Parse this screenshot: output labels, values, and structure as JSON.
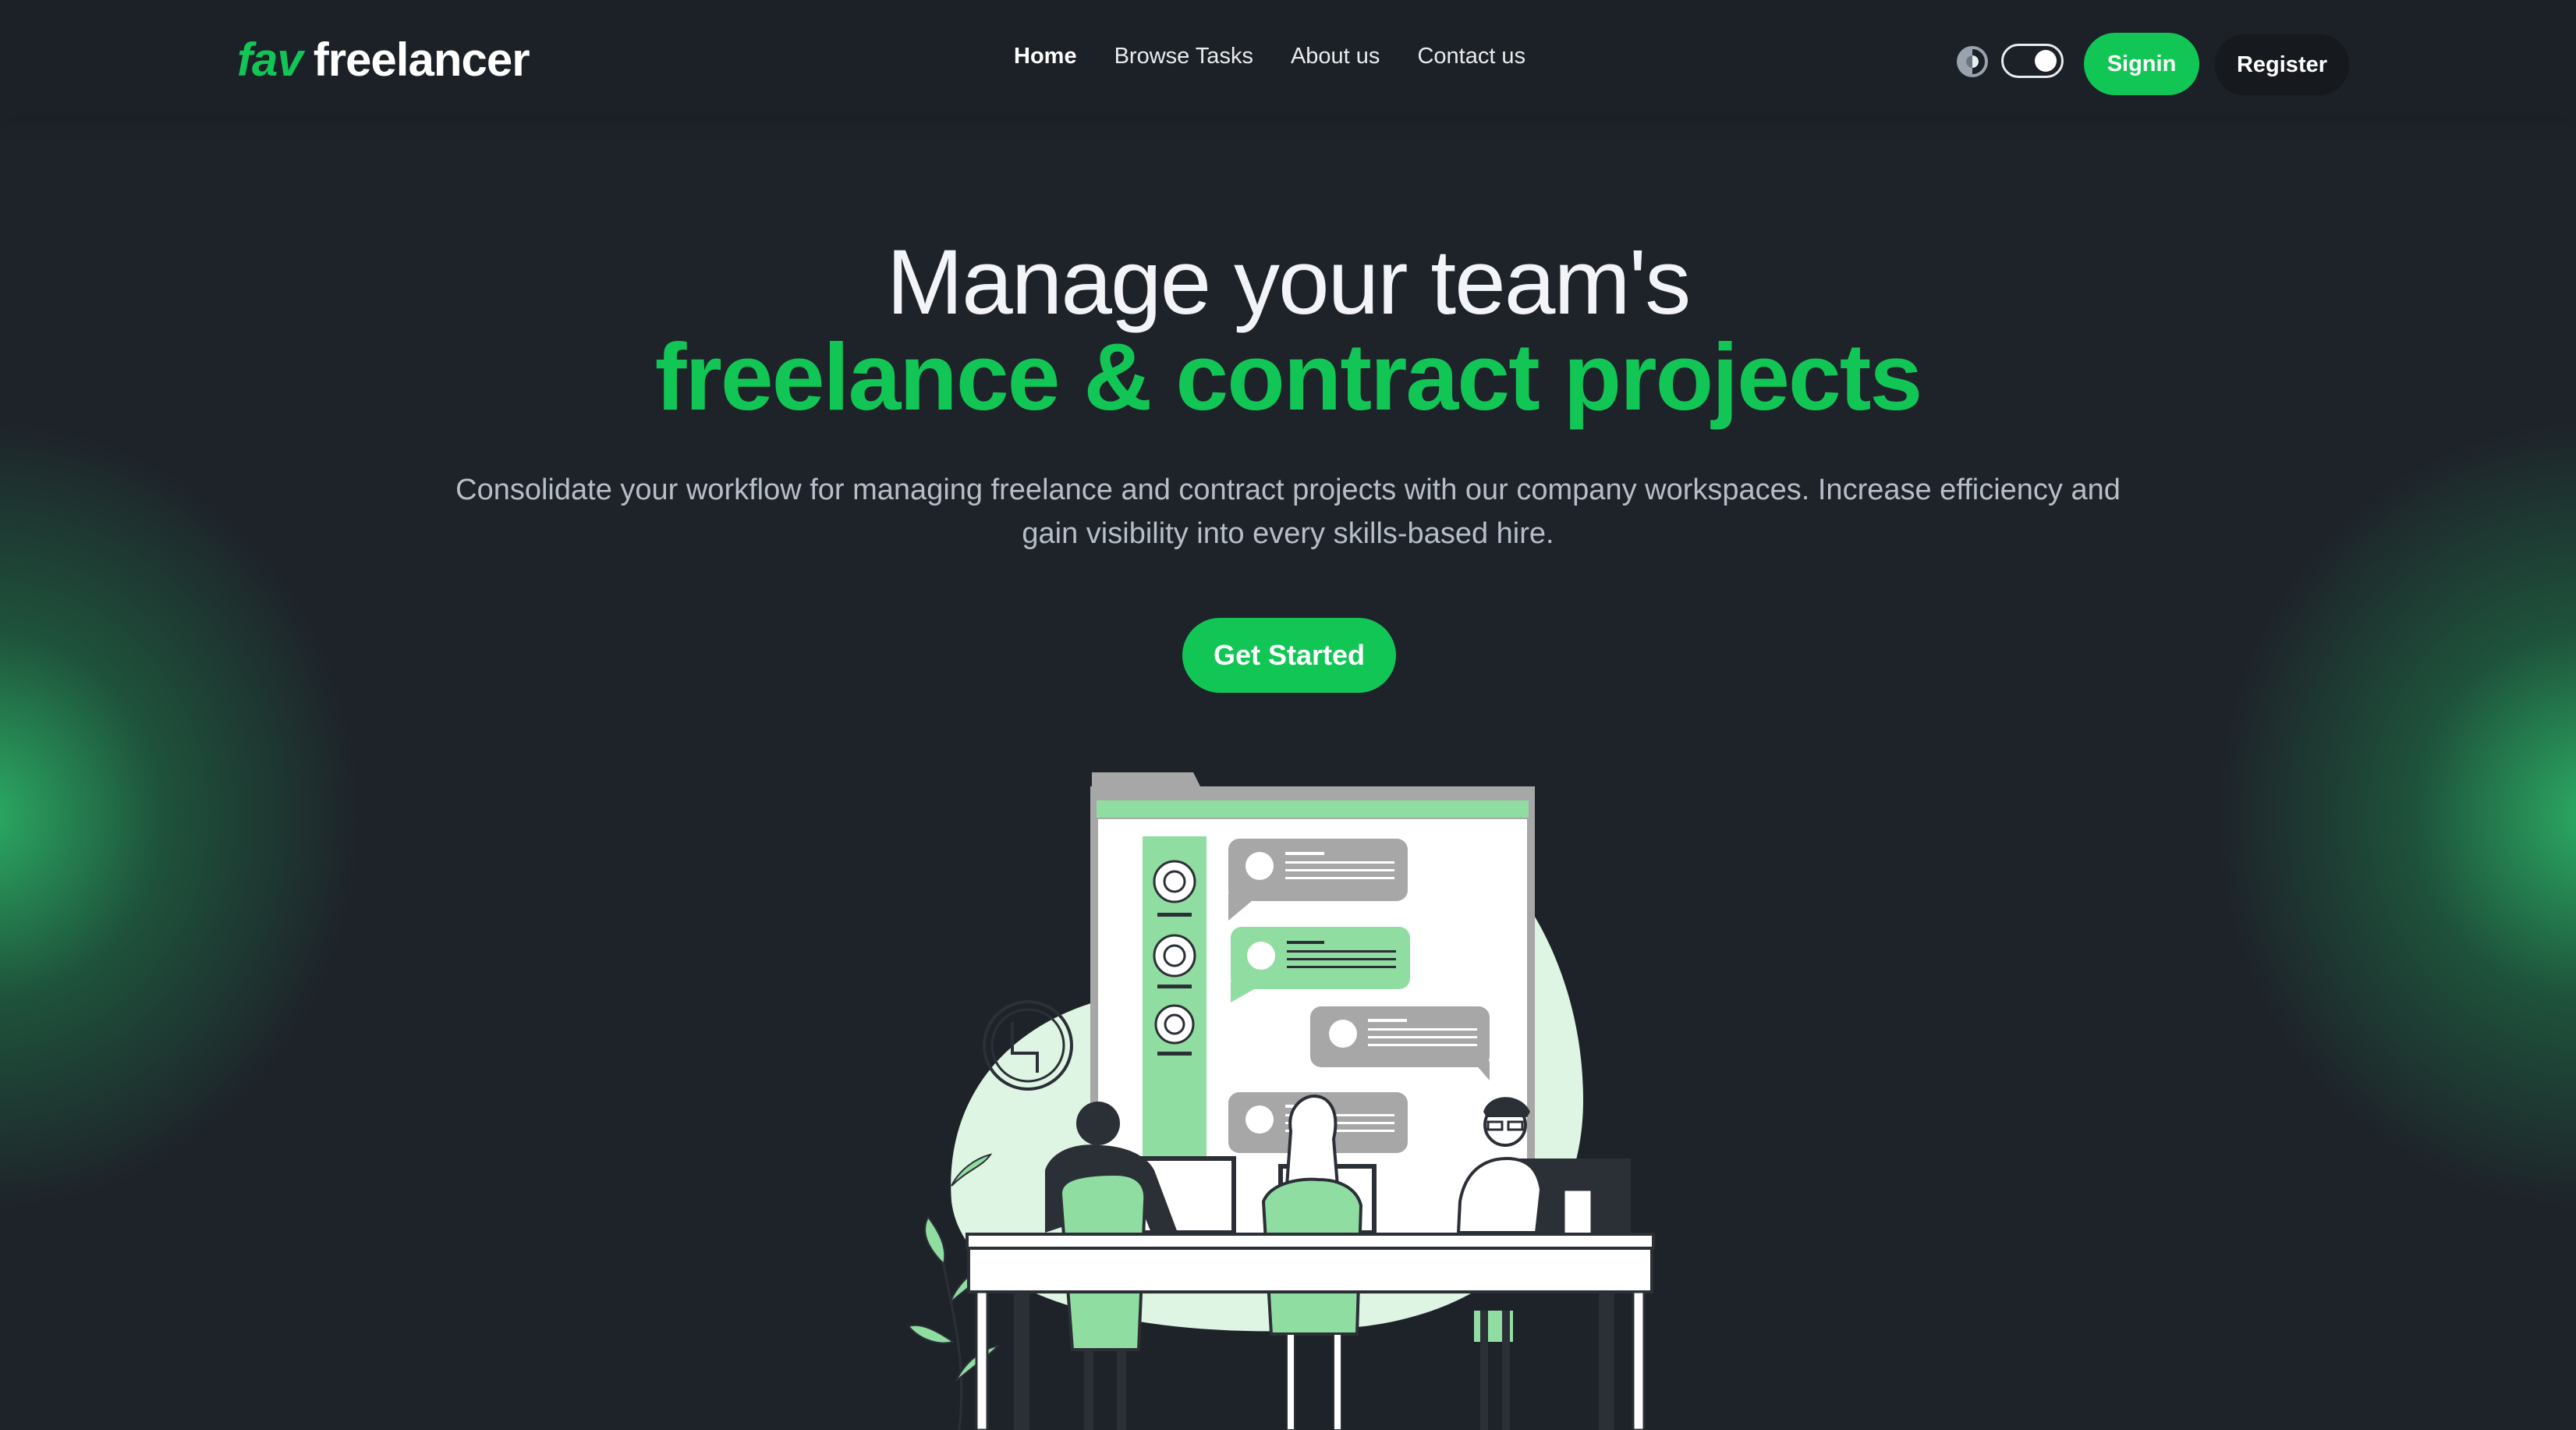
{
  "nav": {
    "logo_prefix": "fav",
    "logo_name": "freelancer",
    "links": [
      "Home",
      "Browse Tasks",
      "About us",
      "Contact us"
    ],
    "active_link": "Home",
    "theme_toggle_on": true,
    "signin_label": "Signin",
    "register_label": "Register"
  },
  "hero": {
    "title_line1": "Manage your team's",
    "title_line2": "freelance & contract projects",
    "subtitle": "Consolidate your workflow for managing freelance and contract projects with our company workspaces. Increase efficiency and gain visibility into every skills-based hire.",
    "cta_label": "Get Started"
  },
  "colors": {
    "accent": "#12c656",
    "background": "#1e232a",
    "navbar": "#1c2027",
    "illustration_light": "#dff5e3",
    "illustration_mid": "#90dda2"
  },
  "icons": {
    "theme": "half-circle-contrast-icon"
  }
}
